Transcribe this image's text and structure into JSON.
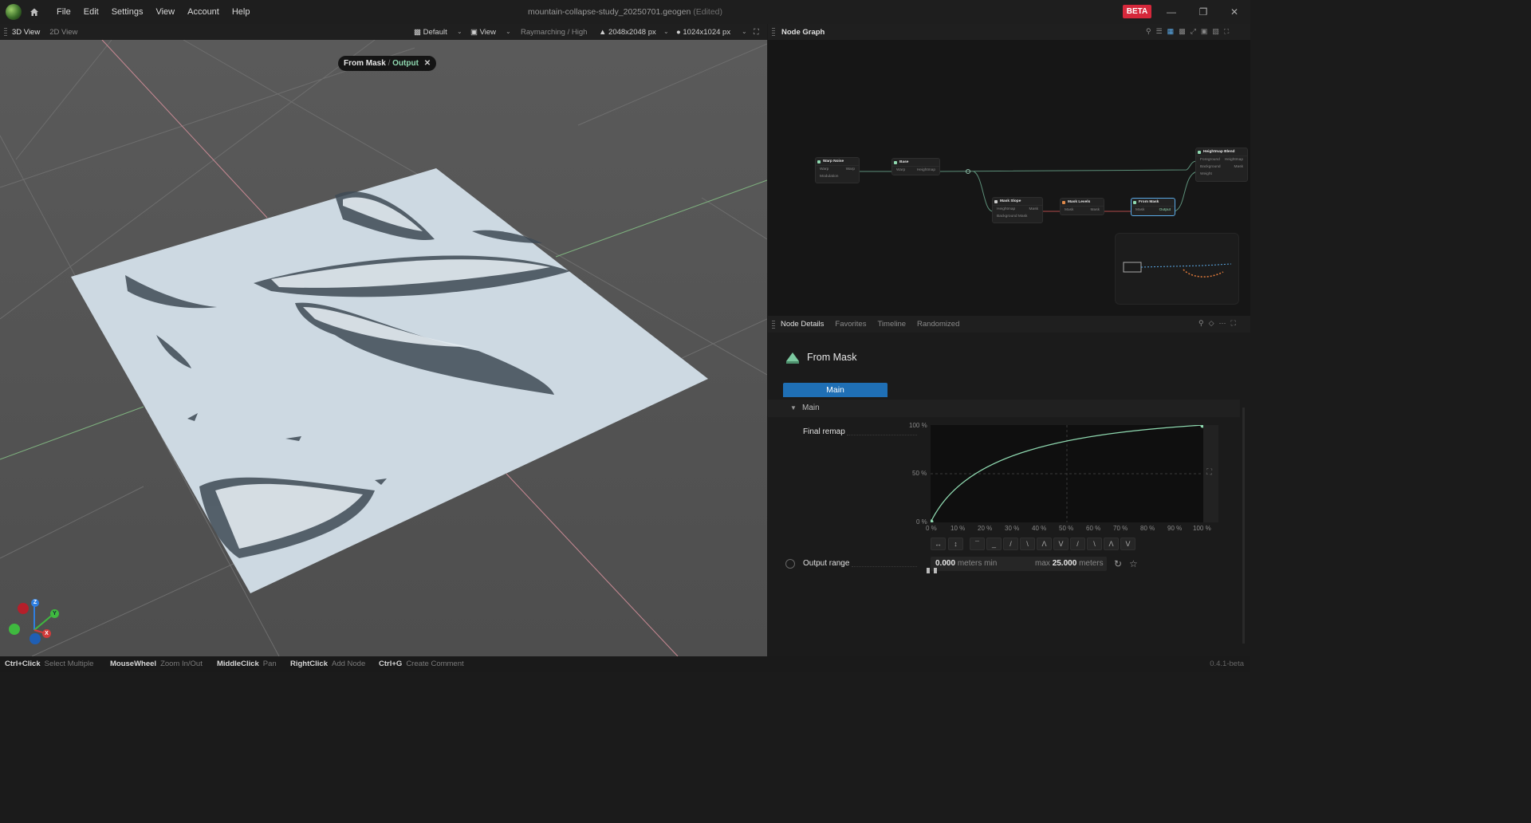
{
  "window": {
    "title": "mountain-collapse-study_20250701.geogen",
    "edited": "(Edited)",
    "badge": "BETA"
  },
  "menu": [
    "File",
    "Edit",
    "Settings",
    "View",
    "Account",
    "Help"
  ],
  "viewport": {
    "tabs": [
      "3D View",
      "2D View"
    ],
    "preset": "Default",
    "view_label": "View",
    "render_mode": "Raymarching / High",
    "resolution": "2048x2048 px",
    "preview_resolution": "1024x1024 px",
    "breadcrumb": {
      "node": "From Mask",
      "separator": " / ",
      "port": "Output"
    },
    "gizmo": {
      "z": "Z",
      "y": "Y",
      "x": "X"
    }
  },
  "node_graph": {
    "title": "Node Graph",
    "nodes": [
      {
        "name": "Warp Noise",
        "inputs": [
          "Warp",
          "Modulation"
        ],
        "outputs": [
          "Warp"
        ]
      },
      {
        "name": "Base",
        "inputs": [
          "Warp"
        ],
        "outputs": [
          "Heightmap"
        ]
      },
      {
        "name": "Mask Slope",
        "inputs": [
          "Heightmap",
          "Background Mask"
        ],
        "outputs": [
          "Mask"
        ]
      },
      {
        "name": "Mask Levels",
        "inputs": [
          "Mask"
        ],
        "outputs": [
          "Mask"
        ]
      },
      {
        "name": "From Mask",
        "inputs": [
          "Mask"
        ],
        "outputs": [
          "Output"
        ]
      },
      {
        "name": "Heightmap Blend",
        "inputs": [
          "Foreground",
          "Background",
          "Weight"
        ],
        "outputs": [
          "Heightmap",
          "Mask"
        ]
      }
    ]
  },
  "node_details": {
    "tabs": [
      "Node Details",
      "Favorites",
      "Timeline",
      "Randomized"
    ],
    "node_name": "From Mask",
    "page_button": "Main",
    "section": "Main",
    "final_remap": {
      "label": "Final remap",
      "y_labels": [
        "100 %",
        "50 %",
        "0 %"
      ],
      "x_labels": [
        "0 %",
        "10 %",
        "20 %",
        "30 %",
        "40 %",
        "50 %",
        "60 %",
        "70 %",
        "80 %",
        "90 %",
        "100 %"
      ]
    },
    "output_range": {
      "label": "Output range",
      "min_value": "0.000",
      "min_unit": "meters min",
      "max_prefix": "max",
      "max_value": "25.000",
      "max_unit": "meters"
    }
  },
  "statusbar": [
    {
      "key": "Ctrl+Click",
      "action": "Select Multiple"
    },
    {
      "key": "MouseWheel",
      "action": "Zoom In/Out"
    },
    {
      "key": "MiddleClick",
      "action": "Pan"
    },
    {
      "key": "RightClick",
      "action": "Add Node"
    },
    {
      "key": "Ctrl+G",
      "action": "Create Comment"
    }
  ],
  "version": "0.4.1-beta",
  "colors": {
    "accent": "#1f6fb5",
    "beta": "#d6283b",
    "curve": "#8fd9b0",
    "selection": "#5aa9e6"
  }
}
